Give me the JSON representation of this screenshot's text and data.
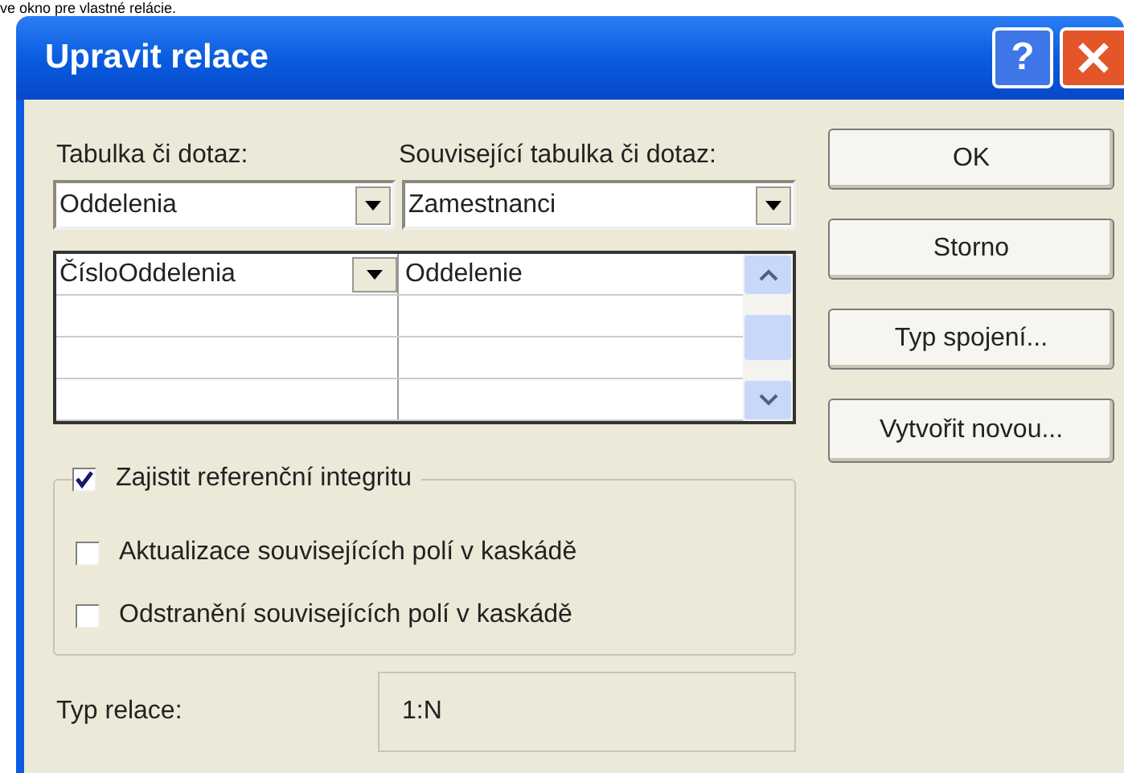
{
  "caption": "ve okno pre vlastné relácie.",
  "window": {
    "title": "Upravit relace",
    "help_button": "?"
  },
  "table_label": "Tabulka či dotaz:",
  "related_label": "Související tabulka či dotaz:",
  "table_combo": {
    "value": "Oddelenia"
  },
  "related_combo": {
    "value": "Zamestnanci"
  },
  "fields_grid": {
    "rows": [
      {
        "cells": [
          "ČísloOddelenia",
          "Oddelenie"
        ]
      }
    ]
  },
  "checkboxes": [
    {
      "label": "Zajistit referenční integritu",
      "checked": true
    },
    {
      "label": "Aktualizace souvisejících polí v kaskádě",
      "checked": false
    },
    {
      "label": "Odstranění souvisejících polí v kaskádě",
      "checked": false
    }
  ],
  "relation_type": {
    "label": "Typ relace:",
    "value": "1:N"
  },
  "buttons": [
    "OK",
    "Storno",
    "Typ spojení...",
    "Vytvořit novou..."
  ]
}
